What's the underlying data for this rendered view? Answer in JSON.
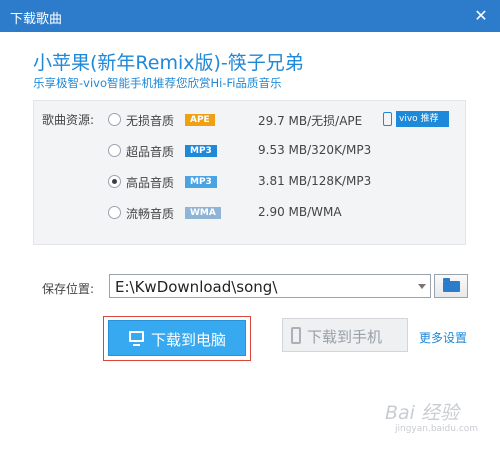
{
  "window": {
    "title": "下载歌曲",
    "close_glyph": "✕"
  },
  "song": {
    "title": "小苹果(新年Remix版)-筷子兄弟",
    "subtitle": "乐享极智-vivo智能手机推荐您欣赏Hi-Fi品质音乐"
  },
  "source": {
    "label": "歌曲资源:",
    "vivo_tag": "vivo 推荐",
    "options": [
      {
        "label": "无损音质",
        "badge": "APE",
        "badge_color": "#f0a012",
        "size": "29.7 MB/无损/APE",
        "checked": false
      },
      {
        "label": "超品音质",
        "badge": "MP3",
        "badge_color": "#1e88d9",
        "size": "9.53 MB/320K/MP3",
        "checked": false
      },
      {
        "label": "高品音质",
        "badge": "MP3",
        "badge_color": "#4aa3e3",
        "size": "3.81 MB/128K/MP3",
        "checked": true
      },
      {
        "label": "流畅音质",
        "badge": "WMA",
        "badge_color": "#8fb4d6",
        "size": "2.90 MB/WMA",
        "checked": false
      }
    ]
  },
  "save": {
    "label": "保存位置:",
    "path": "E:\\KwDownload\\song\\"
  },
  "actions": {
    "download_pc": "下载到电脑",
    "download_phone": "下载到手机",
    "more_settings": "更多设置"
  },
  "watermark": {
    "logo": "Bai 经验",
    "url": "jingyan.baidu.com"
  },
  "colors": {
    "titlebar": "#2d7ccb",
    "accent": "#1e88d9",
    "primary_button": "#36a9f0",
    "highlight_border": "#d9453a"
  }
}
